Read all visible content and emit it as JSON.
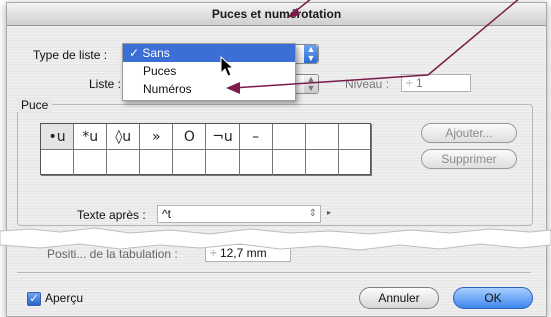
{
  "window": {
    "title": "Puces et numérotation"
  },
  "type_liste": {
    "label": "Type de liste :",
    "menu_items": [
      "✓ Sans",
      "Puces",
      "Numéros"
    ]
  },
  "liste": {
    "label": "Liste :"
  },
  "niveau": {
    "label": "Niveau :",
    "value": "1"
  },
  "puce": {
    "title": "Puce",
    "glyphs": [
      "•u",
      "*u",
      "◊u",
      "»",
      "O",
      "¬u",
      "–",
      "",
      "",
      "",
      "",
      "",
      "",
      "",
      "",
      "",
      "",
      "",
      "",
      ""
    ],
    "add_button": "Ajouter...",
    "delete_button": "Supprimer"
  },
  "texte_apres": {
    "label": "Texte après :",
    "value": "^t"
  },
  "tabulation": {
    "label": "Positi... de la tabulation :",
    "value": "12,7 mm"
  },
  "apercu": {
    "label": "Aperçu",
    "checked": true
  },
  "buttons": {
    "cancel": "Annuler",
    "ok": "OK"
  },
  "colors": {
    "accent": "#3b6fd6",
    "annotation": "#7a1b48"
  }
}
